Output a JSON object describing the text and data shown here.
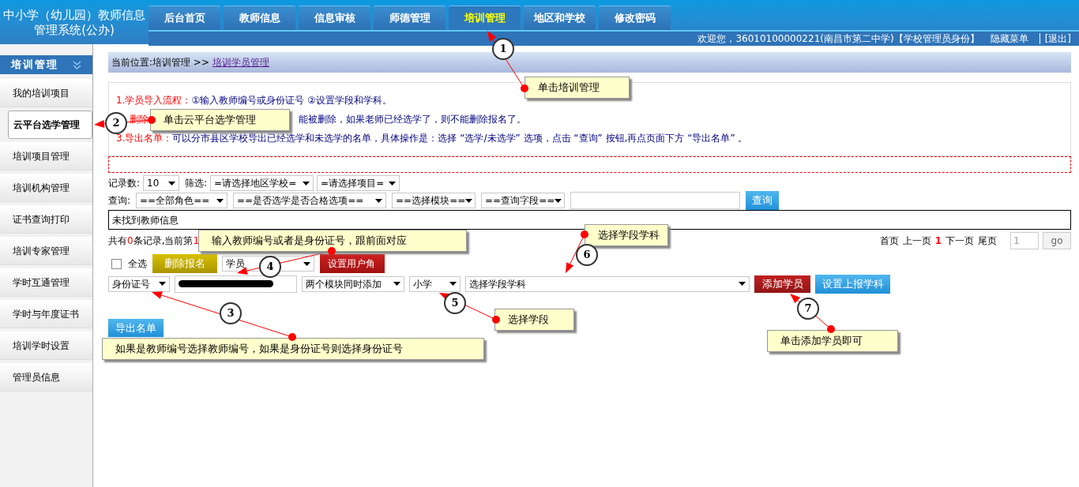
{
  "header": {
    "title_lines": [
      "中小学（幼儿园）教师信息",
      "管理系统(公办)"
    ],
    "tabs": [
      {
        "label": "后台首页",
        "selected": false
      },
      {
        "label": "教师信息",
        "selected": false
      },
      {
        "label": "信息审核",
        "selected": false
      },
      {
        "label": "师德管理",
        "selected": false
      },
      {
        "label": "培训管理",
        "selected": true
      },
      {
        "label": "地区和学校",
        "selected": false
      },
      {
        "label": "修改密码",
        "selected": false
      }
    ],
    "welcome": "欢迎您，36010100000221(南昌市第二中学)【学校管理员身份】",
    "hide_menu": "隐藏菜单",
    "logout": "[退出]"
  },
  "sidebar": {
    "title": "培训管理",
    "items": [
      {
        "label": "我的培训项目",
        "selected": false
      },
      {
        "label": "云平台选学管理",
        "selected": true
      },
      {
        "label": "培训项目管理",
        "selected": false
      },
      {
        "label": "培训机构管理",
        "selected": false
      },
      {
        "label": "证书查询打印",
        "selected": false
      },
      {
        "label": "培训专家管理",
        "selected": false
      },
      {
        "label": "学时互通管理",
        "selected": false
      },
      {
        "label": "学时与年度证书",
        "selected": false
      },
      {
        "label": "培训学时设置",
        "selected": false
      },
      {
        "label": "管理员信息",
        "selected": false
      }
    ]
  },
  "breadcrumb": {
    "prefix": "当前位置:培训管理 >>",
    "link": "培训学员管理"
  },
  "notes": [
    {
      "kind": "full",
      "label": "1.学员导入流程：",
      "text": "①输入教师编号或身份证号  ②设置学段和学科。"
    },
    {
      "kind": "covered",
      "label": "删除",
      "text": "能被删除，如果老师已经选学了，则不能删除报名了。"
    },
    {
      "kind": "full",
      "label": "3.导出名单：",
      "text": "可以分市县区学校导出已经选学和未选学的名单，具体操作是：选择 “选学/未选学” 选项，点击 “查询” 按钮,再点页面下方 “导出名单” 。"
    }
  ],
  "filter": {
    "records_label": "记录数:",
    "records": "10",
    "filter_label": "筛选:",
    "selects": [
      "=请选择地区学校=",
      "=请选择项目="
    ]
  },
  "query": {
    "label": "查询:",
    "selects": [
      "==全部角色==",
      "==是否选学是否合格选项==",
      "==选择模块==",
      "==查询字段=="
    ],
    "button": "查询"
  },
  "result": "未找到教师信息",
  "summary": [
    {
      "text": "共有",
      "emphasis": false
    },
    {
      "text": "0",
      "emphasis": true
    },
    {
      "text": "条记录,当前第",
      "emphasis": false
    },
    {
      "text": "1",
      "emphasis": true
    }
  ],
  "pager": {
    "links": [
      "首页",
      "上一页"
    ],
    "current": "1",
    "links_after": [
      "下一页",
      "尾页"
    ],
    "page_input": "1",
    "go": "go"
  },
  "actions": {
    "select_all": {
      "label": "全选",
      "checked": false
    },
    "delete": "删除报名",
    "role": "学员",
    "set_role": "设置用户角"
  },
  "add_row": {
    "id_type": "身份证号",
    "module": "两个模块同时添加",
    "stage": "小学",
    "subject": "选择学段学科",
    "add": "添加学员",
    "set_subject": "设置上报学科"
  },
  "export": "导出名单",
  "annotations": [
    {
      "number": "1",
      "text": "单击培训管理"
    },
    {
      "number": "2",
      "text": "单击云平台选学管理"
    },
    {
      "number": "4",
      "text": "输入教师编号或者是身份证号，跟前面对应"
    },
    {
      "number": "3",
      "text": "如果是教师编号选择教师编号，如果是身份证号则选择身份证号"
    },
    {
      "number": "5",
      "text": "选择学段"
    },
    {
      "number": "6",
      "text": "选择学段学科"
    },
    {
      "number": "7",
      "text": "单击添加学员即可"
    }
  ]
}
